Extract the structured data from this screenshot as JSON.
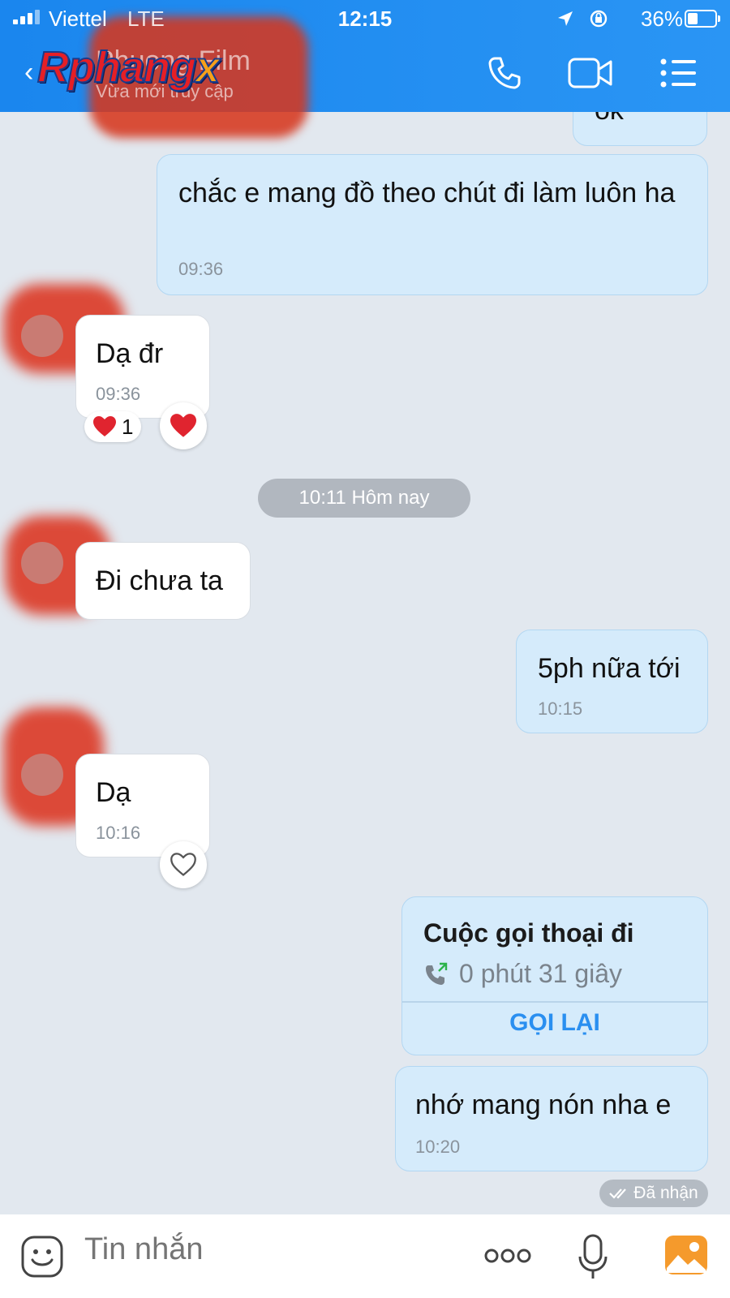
{
  "status_bar": {
    "carrier": "Viettel",
    "network": "LTE",
    "time": "12:15",
    "battery": "36%"
  },
  "header": {
    "contact_name": "Phuong Film",
    "contact_status": "Vừa mới truy cập",
    "watermark": "Rphangx"
  },
  "messages": [
    {
      "id": "m0",
      "side": "mine",
      "text": "ok",
      "time": ""
    },
    {
      "id": "m1",
      "side": "mine",
      "text": "chắc e mang đồ theo chút đi làm luôn ha",
      "time": "09:36"
    },
    {
      "id": "m2",
      "side": "theirs",
      "text": "Dạ đr",
      "time": "09:36",
      "reaction": {
        "emoji": "❤️",
        "count": "1"
      }
    },
    {
      "id": "m3",
      "side": "theirs",
      "text": "Đi chưa ta",
      "time": ""
    },
    {
      "id": "m4",
      "side": "mine",
      "text": "5ph nữa tới",
      "time": "10:15"
    },
    {
      "id": "m5",
      "side": "theirs",
      "text": "Dạ",
      "time": "10:16"
    },
    {
      "id": "m6",
      "side": "mine",
      "type": "call",
      "title": "Cuộc gọi thoại đi",
      "duration": "0 phút 31 giây",
      "action": "GỌI LẠI"
    },
    {
      "id": "m7",
      "side": "mine",
      "text": "nhớ mang nón nha e",
      "time": "10:20"
    }
  ],
  "date_separator": "10:11 Hôm nay",
  "seen_status": "Đã nhận",
  "composer": {
    "placeholder": "Tin nhắn"
  },
  "colors": {
    "header": "#1a86ee",
    "mine_bubble": "#d5ebfb",
    "theirs_bubble": "#ffffff",
    "background": "#e2e8ef",
    "accent": "#2a8ff0",
    "heart": "#e0242f"
  },
  "icons": [
    "phone-icon",
    "video-icon",
    "menu-icon",
    "back-icon",
    "emoji-icon",
    "more-icon",
    "mic-icon",
    "gallery-icon",
    "heart-icon",
    "call-outgoing-icon",
    "double-check-icon"
  ]
}
